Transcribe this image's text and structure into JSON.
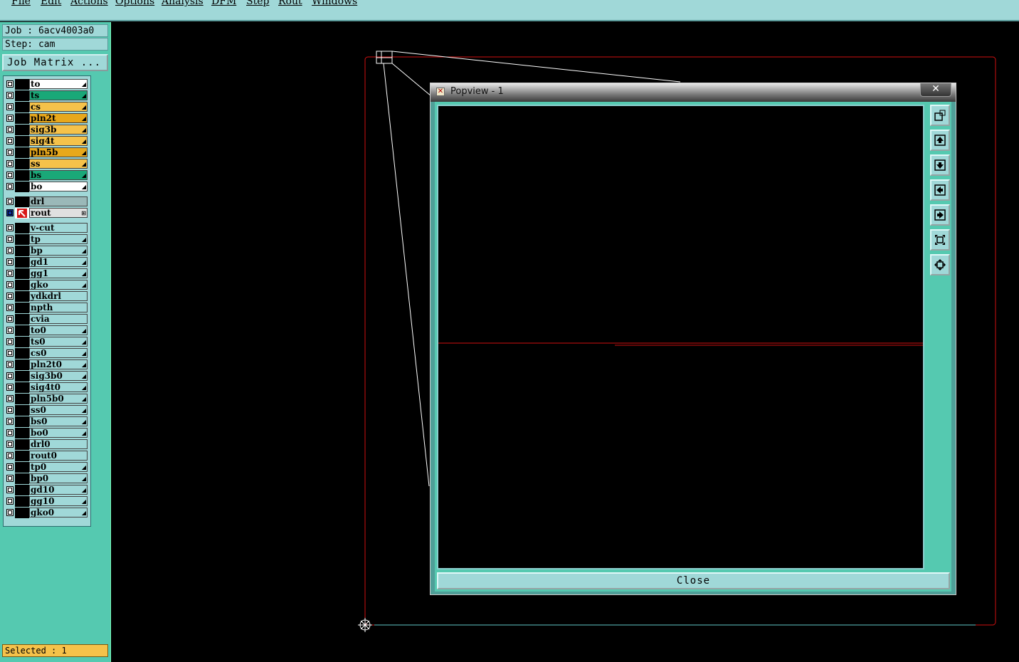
{
  "menu": [
    {
      "label": "File"
    },
    {
      "label": "Edit"
    },
    {
      "label": "Actions"
    },
    {
      "label": "Options"
    },
    {
      "label": "Analysis"
    },
    {
      "label": "DFM"
    },
    {
      "label": "Step"
    },
    {
      "label": "Rout"
    },
    {
      "label": "Windows"
    }
  ],
  "info": {
    "job": "Job : 6acv4003a0",
    "step": "Step: cam",
    "job_matrix_button": "Job Matrix ..."
  },
  "layers": [
    {
      "name": "to",
      "color": "#ffffff",
      "mark": "◢"
    },
    {
      "name": "ts",
      "color": "#1aa878",
      "mark": "◢"
    },
    {
      "name": "cs",
      "color": "#f5c24a",
      "mark": "◢"
    },
    {
      "name": "pln2t",
      "color": "#e8a81c",
      "mark": "◢"
    },
    {
      "name": "sig3b",
      "color": "#f5c24a",
      "mark": "◢"
    },
    {
      "name": "sig4t",
      "color": "#f5c24a",
      "mark": "◢"
    },
    {
      "name": "pln5b",
      "color": "#e8a81c",
      "mark": "◢"
    },
    {
      "name": "ss",
      "color": "#f5c24a",
      "mark": "◢"
    },
    {
      "name": "bs",
      "color": "#1aa878",
      "mark": "◢"
    },
    {
      "name": "bo",
      "color": "#ffffff",
      "mark": "◢"
    },
    {
      "name": "drl",
      "color": "#9ab8b8",
      "mark": ""
    },
    {
      "name": "rout",
      "color": "#e0e0e0",
      "mark": "⊞",
      "active": true
    },
    {
      "name": "v-cut",
      "color": "#a0d8d8",
      "mark": ""
    },
    {
      "name": "tp",
      "color": "#a0d8d8",
      "mark": "◢"
    },
    {
      "name": "bp",
      "color": "#a0d8d8",
      "mark": "◢"
    },
    {
      "name": "gd1",
      "color": "#a0d8d8",
      "mark": "◢"
    },
    {
      "name": "gg1",
      "color": "#a0d8d8",
      "mark": "◢"
    },
    {
      "name": "gko",
      "color": "#a0d8d8",
      "mark": "◢"
    },
    {
      "name": "ydkdrl",
      "color": "#a0d8d8",
      "mark": ""
    },
    {
      "name": "npth",
      "color": "#a0d8d8",
      "mark": ""
    },
    {
      "name": "cvia",
      "color": "#a0d8d8",
      "mark": ""
    },
    {
      "name": "to0",
      "color": "#a0d8d8",
      "mark": "◢"
    },
    {
      "name": "ts0",
      "color": "#a0d8d8",
      "mark": "◢"
    },
    {
      "name": "cs0",
      "color": "#a0d8d8",
      "mark": "◢"
    },
    {
      "name": "pln2t0",
      "color": "#a0d8d8",
      "mark": "◢"
    },
    {
      "name": "sig3b0",
      "color": "#a0d8d8",
      "mark": "◢"
    },
    {
      "name": "sig4t0",
      "color": "#a0d8d8",
      "mark": "◢"
    },
    {
      "name": "pln5b0",
      "color": "#a0d8d8",
      "mark": "◢"
    },
    {
      "name": "ss0",
      "color": "#a0d8d8",
      "mark": "◢"
    },
    {
      "name": "bs0",
      "color": "#a0d8d8",
      "mark": "◢"
    },
    {
      "name": "bo0",
      "color": "#a0d8d8",
      "mark": "◢"
    },
    {
      "name": "drl0",
      "color": "#a0d8d8",
      "mark": ""
    },
    {
      "name": "rout0",
      "color": "#a0d8d8",
      "mark": ""
    },
    {
      "name": "tp0",
      "color": "#a0d8d8",
      "mark": "◢"
    },
    {
      "name": "bp0",
      "color": "#a0d8d8",
      "mark": "◢"
    },
    {
      "name": "gd10",
      "color": "#a0d8d8",
      "mark": "◢"
    },
    {
      "name": "gg10",
      "color": "#a0d8d8",
      "mark": "◢"
    },
    {
      "name": "gko0",
      "color": "#a0d8d8",
      "mark": "◢"
    }
  ],
  "status": {
    "selected": "Selected : 1"
  },
  "popview": {
    "title": "Popview - 1",
    "close_x": "✕",
    "close_button": "Close",
    "toolbar_icons": [
      "zoom-window-icon",
      "pan-up-icon",
      "pan-down-icon",
      "pan-left-icon",
      "pan-right-icon",
      "zoom-fit-icon",
      "zoom-center-icon"
    ]
  },
  "colors": {
    "menubar": "#a0d8d8",
    "panel": "#55c9b0",
    "profile_line": "#d01010",
    "status": "#f5c24a"
  }
}
